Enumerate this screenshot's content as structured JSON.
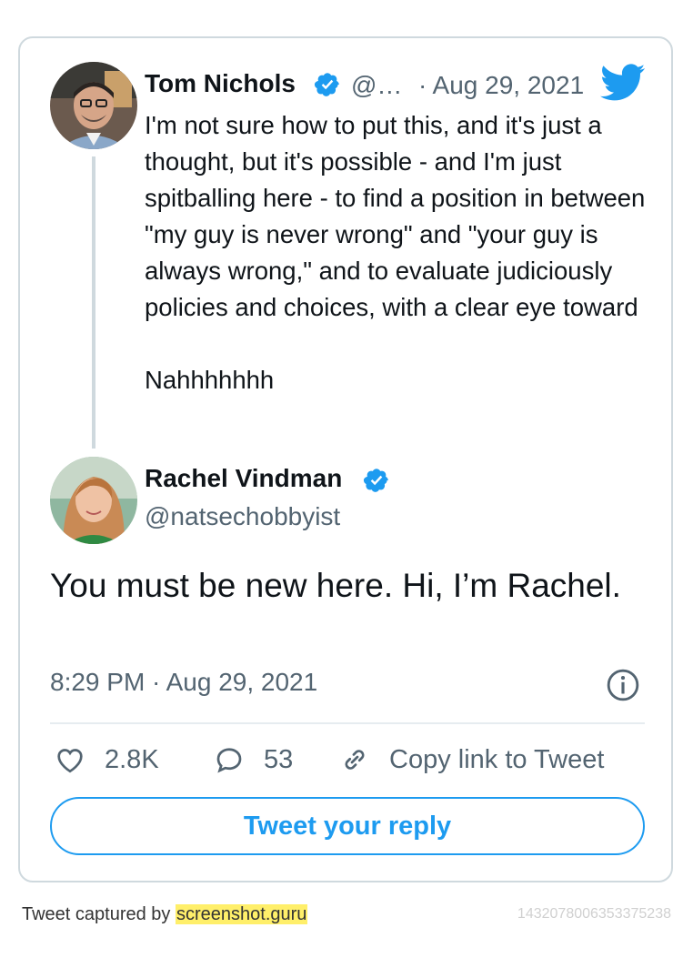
{
  "quoted_tweet": {
    "author_name": "Tom Nichols",
    "handle": "@…",
    "date": "· Aug 29, 2021",
    "text": "I'm not sure how to put this, and it's just a thought, but it's possible - and I'm just spitballing here - to find a position in between \"my guy is never wrong\" and \"your guy is always wrong,\" and to evaluate judiciously policies and choices, with a clear eye toward\n\nNahhhhhhh"
  },
  "reply_tweet": {
    "author_name": "Rachel Vindman",
    "handle": "@natsechobbyist",
    "text": "You must be new here. Hi, I’m Rachel.",
    "timestamp": "8:29 PM · Aug 29, 2021"
  },
  "actions": {
    "likes": "2.8K",
    "replies": "53",
    "copy_link_label": "Copy link to Tweet"
  },
  "reply_button_label": "Tweet your reply",
  "footer": {
    "prefix": "Tweet captured by ",
    "site": "screenshot.guru",
    "tweet_id": "1432078006353375238"
  },
  "colors": {
    "accent": "#1d9bf0",
    "muted_text": "#536471",
    "border": "#cfd9de",
    "highlight": "#ffef6a"
  },
  "icons": [
    "twitter-bird-icon",
    "verified-badge-icon",
    "heart-icon",
    "reply-bubble-icon",
    "link-icon",
    "info-icon"
  ]
}
